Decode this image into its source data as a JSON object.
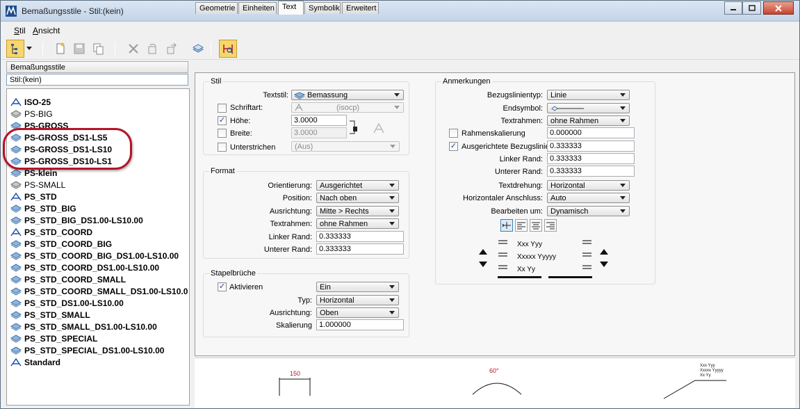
{
  "window": {
    "title": "Bemaßungsstile - Stil:(kein)"
  },
  "menu": [
    {
      "label_u": "S",
      "label_rest": "til"
    },
    {
      "label_u": "A",
      "label_rest": "nsicht"
    }
  ],
  "left": {
    "header": "Bemaßungsstile",
    "filter": "Stil:(kein)",
    "items": [
      {
        "label": "ISO-25",
        "bold": true,
        "icon": "dimension-style-icon"
      },
      {
        "label": "PS-BIG",
        "bold": false,
        "icon": "library-style-icon"
      },
      {
        "label": "PS-GROSS",
        "bold": true,
        "icon": "style-icon"
      },
      {
        "label": "PS-GROSS_DS1-LS5",
        "bold": true,
        "icon": "style-icon"
      },
      {
        "label": "PS-GROSS_DS1-LS10",
        "bold": true,
        "icon": "style-icon"
      },
      {
        "label": "PS-GROSS_DS10-LS1",
        "bold": true,
        "icon": "style-icon"
      },
      {
        "label": "PS-klein",
        "bold": true,
        "icon": "style-icon"
      },
      {
        "label": "PS-SMALL",
        "bold": false,
        "icon": "library-style-icon"
      },
      {
        "label": "PS_STD",
        "bold": true,
        "icon": "dimension-style-icon"
      },
      {
        "label": "PS_STD_BIG",
        "bold": true,
        "icon": "style-icon"
      },
      {
        "label": "PS_STD_BIG_DS1.00-LS10.00",
        "bold": true,
        "icon": "style-icon"
      },
      {
        "label": "PS_STD_COORD",
        "bold": true,
        "icon": "dimension-style-icon"
      },
      {
        "label": "PS_STD_COORD_BIG",
        "bold": true,
        "icon": "style-icon"
      },
      {
        "label": "PS_STD_COORD_BIG_DS1.00-LS10.00",
        "bold": true,
        "icon": "style-icon"
      },
      {
        "label": "PS_STD_COORD_DS1.00-LS10.00",
        "bold": true,
        "icon": "style-icon"
      },
      {
        "label": "PS_STD_COORD_SMALL",
        "bold": true,
        "icon": "style-icon"
      },
      {
        "label": "PS_STD_COORD_SMALL_DS1.00-LS10.0",
        "bold": true,
        "icon": "style-icon"
      },
      {
        "label": "PS_STD_DS1.00-LS10.00",
        "bold": true,
        "icon": "style-icon"
      },
      {
        "label": "PS_STD_SMALL",
        "bold": true,
        "icon": "style-icon"
      },
      {
        "label": "PS_STD_SMALL_DS1.00-LS10.00",
        "bold": true,
        "icon": "style-icon"
      },
      {
        "label": "PS_STD_SPECIAL",
        "bold": true,
        "icon": "style-icon"
      },
      {
        "label": "PS_STD_SPECIAL_DS1.00-LS10.00",
        "bold": true,
        "icon": "style-icon"
      },
      {
        "label": "Standard",
        "bold": true,
        "icon": "dimension-style-icon"
      }
    ]
  },
  "tabs": [
    "Geometrie",
    "Einheiten",
    "Text",
    "Symbolik",
    "Erweitert"
  ],
  "selected_tab": "Text",
  "stil": {
    "title": "Stil",
    "textstil_label": "Textstil:",
    "textstil_value": "Bemassung",
    "schriftart_label": "Schriftart:",
    "schriftart_value": "(isocp)",
    "hoehe_label": "Höhe:",
    "hoehe_value": "3.0000",
    "breite_label": "Breite:",
    "breite_value": "3.0000",
    "unterstrichen_label": "Unterstrichen",
    "unterstrichen_value": "(Aus)"
  },
  "format": {
    "title": "Format",
    "orientierung_label": "Orientierung:",
    "orientierung_value": "Ausgerichtet",
    "position_label": "Position:",
    "position_value": "Nach oben",
    "ausrichtung_label": "Ausrichtung:",
    "ausrichtung_value": "Mitte > Rechts",
    "textrahmen_label": "Textrahmen:",
    "textrahmen_value": "ohne Rahmen",
    "linker_rand_label": "Linker Rand:",
    "linker_rand_value": "0.333333",
    "unterer_rand_label": "Unterer Rand:",
    "unterer_rand_value": "0.333333"
  },
  "stapel": {
    "title": "Stapelbrüche",
    "aktivieren_label": "Aktivieren",
    "aktivieren_value": "Ein",
    "typ_label": "Typ:",
    "typ_value": "Horizontal",
    "ausrichtung_label": "Ausrichtung:",
    "ausrichtung_value": "Oben",
    "skalierung_label": "Skalierung",
    "skalierung_value": "1.000000"
  },
  "anmerkungen": {
    "title": "Anmerkungen",
    "bezugslinientyp_label": "Bezugslinientyp:",
    "bezugslinientyp_value": "Linie",
    "endsymbol_label": "Endsymbol:",
    "textrahmen_label": "Textrahmen:",
    "textrahmen_value": "ohne Rahmen",
    "rahmenskalierung_label": "Rahmenskalierung",
    "rahmenskalierung_value": "0.000000",
    "ausgerichtete_label": "Ausgerichtete Bezugslinie",
    "ausgerichtete_value": "0.333333",
    "linker_rand_label": "Linker Rand:",
    "linker_rand_value": "0.333333",
    "unterer_rand_label": "Unterer Rand:",
    "unterer_rand_value": "0.333333",
    "textdrehung_label": "Textdrehung:",
    "textdrehung_value": "Horizontal",
    "horiz_anschluss_label": "Horizontaler Anschluss:",
    "horiz_anschluss_value": "Auto",
    "bearbeiten_label": "Bearbeiten um:",
    "bearbeiten_value": "Dynamisch",
    "samples": [
      "Xxx Yyy",
      "Xxxxx Yyyyy",
      "Xx Yy"
    ]
  },
  "preview": {
    "linear_value": "150",
    "angular_value": "60°",
    "note_lines": [
      "Xxx Yyy",
      "Xxxxx Yyyyy",
      "Xx Yy"
    ]
  }
}
